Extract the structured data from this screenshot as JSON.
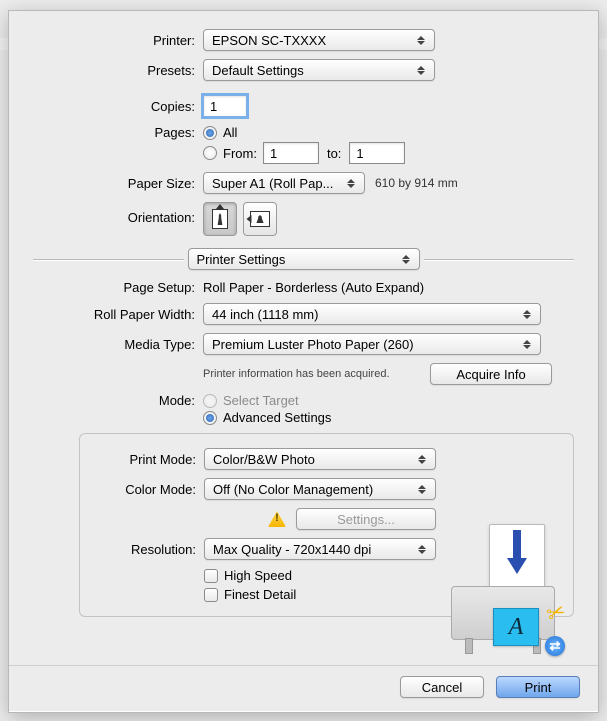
{
  "labels": {
    "printer": "Printer:",
    "presets": "Presets:",
    "copies": "Copies:",
    "pages": "Pages:",
    "all": "All",
    "from": "From:",
    "to": "to:",
    "paper_size": "Paper Size:",
    "orientation": "Orientation:",
    "page_setup": "Page Setup:",
    "roll_paper_width": "Roll Paper Width:",
    "media_type": "Media Type:",
    "mode": "Mode:",
    "print_mode": "Print Mode:",
    "color_mode": "Color Mode:",
    "resolution": "Resolution:"
  },
  "printer": {
    "selected": "EPSON SC-TXXXX"
  },
  "presets": {
    "selected": "Default Settings"
  },
  "copies": {
    "value": "1"
  },
  "pages": {
    "all_selected": true,
    "from_value": "1",
    "to_value": "1"
  },
  "paper_size": {
    "selected": "Super A1 (Roll Pap...",
    "dimensions": "610 by 914 mm"
  },
  "section_popup": {
    "selected": "Printer Settings"
  },
  "page_setup_value": "Roll Paper - Borderless (Auto Expand)",
  "roll_paper_width": {
    "selected": "44 inch (1118 mm)"
  },
  "media_type": {
    "selected": "Premium Luster Photo Paper (260)"
  },
  "printer_info_text": "Printer information has been acquired.",
  "acquire_info_btn": "Acquire Info",
  "mode": {
    "select_target": "Select Target",
    "advanced": "Advanced Settings",
    "advanced_selected": true
  },
  "print_mode": {
    "selected": "Color/B&W Photo"
  },
  "color_mode": {
    "selected": "Off (No Color Management)"
  },
  "settings_btn": "Settings...",
  "resolution": {
    "selected": "Max Quality - 720x1440 dpi"
  },
  "checkboxes": {
    "high_speed": "High Speed",
    "finest_detail": "Finest Detail"
  },
  "illustration_letter": "A",
  "footer": {
    "cancel": "Cancel",
    "print": "Print"
  }
}
